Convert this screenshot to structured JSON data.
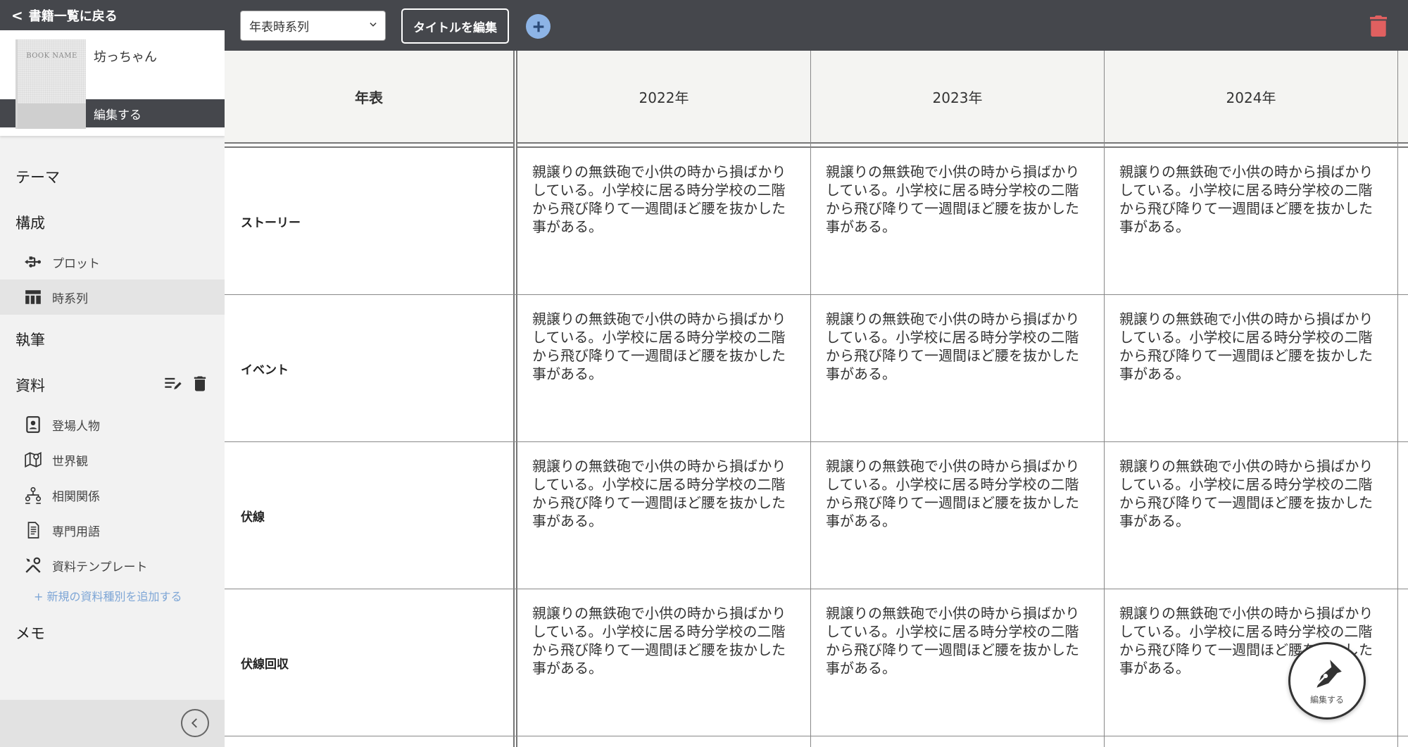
{
  "sidebar": {
    "back_label": "書籍一覧に戻る",
    "book": {
      "cover_label": "BOOK NAME",
      "title": "坊っちゃん",
      "edit_label": "編集する"
    },
    "sections": {
      "theme": "テーマ",
      "structure": "構成",
      "writing": "執筆",
      "materials": "資料",
      "memo": "メモ"
    },
    "structure_items": [
      {
        "label": "プロット",
        "icon": "usb-icon"
      },
      {
        "label": "時系列",
        "icon": "table-icon",
        "active": true
      }
    ],
    "material_items": [
      {
        "label": "登場人物",
        "icon": "person-card-icon"
      },
      {
        "label": "世界観",
        "icon": "map-icon"
      },
      {
        "label": "相関関係",
        "icon": "relationship-icon"
      },
      {
        "label": "専門用語",
        "icon": "document-icon"
      },
      {
        "label": "資料テンプレート",
        "icon": "tools-icon"
      }
    ],
    "add_material_label": "+ 新規の資料種別を追加する"
  },
  "toolbar": {
    "mode_selected": "年表時系列",
    "edit_title_label": "タイトルを編集",
    "accent_color": "#8db4e6",
    "delete_color": "#e06060"
  },
  "timeline": {
    "corner_label": "年表",
    "columns": [
      "2022年",
      "2023年",
      "2024年"
    ],
    "rows": [
      {
        "label": "ストーリー",
        "cells": [
          "親譲りの無鉄砲で小供の時から損ばかりしている。小学校に居る時分学校の二階から飛び降りて一週間ほど腰を抜かした事がある。",
          "親譲りの無鉄砲で小供の時から損ばかりしている。小学校に居る時分学校の二階から飛び降りて一週間ほど腰を抜かした事がある。",
          "親譲りの無鉄砲で小供の時から損ばかりしている。小学校に居る時分学校の二階から飛び降りて一週間ほど腰を抜かした事がある。"
        ]
      },
      {
        "label": "イベント",
        "cells": [
          "親譲りの無鉄砲で小供の時から損ばかりしている。小学校に居る時分学校の二階から飛び降りて一週間ほど腰を抜かした事がある。",
          "親譲りの無鉄砲で小供の時から損ばかりしている。小学校に居る時分学校の二階から飛び降りて一週間ほど腰を抜かした事がある。",
          "親譲りの無鉄砲で小供の時から損ばかりしている。小学校に居る時分学校の二階から飛び降りて一週間ほど腰を抜かした事がある。"
        ]
      },
      {
        "label": "伏線",
        "cells": [
          "親譲りの無鉄砲で小供の時から損ばかりしている。小学校に居る時分学校の二階から飛び降りて一週間ほど腰を抜かした事がある。",
          "親譲りの無鉄砲で小供の時から損ばかりしている。小学校に居る時分学校の二階から飛び降りて一週間ほど腰を抜かした事がある。",
          "親譲りの無鉄砲で小供の時から損ばかりしている。小学校に居る時分学校の二階から飛び降りて一週間ほど腰を抜かした事がある。"
        ]
      },
      {
        "label": "伏線回収",
        "cells": [
          "親譲りの無鉄砲で小供の時から損ばかりしている。小学校に居る時分学校の二階から飛び降りて一週間ほど腰を抜かした事がある。",
          "親譲りの無鉄砲で小供の時から損ばかりしている。小学校に居る時分学校の二階から飛び降りて一週間ほど腰を抜かした事がある。",
          "親譲りの無鉄砲で小供の時から損ばかりしている。小学校に居る時分学校の二階から飛び降りて一週間ほど腰を抜かした事がある。"
        ]
      }
    ]
  },
  "fab": {
    "label": "編集する",
    "icon": "pen-nib-icon"
  }
}
